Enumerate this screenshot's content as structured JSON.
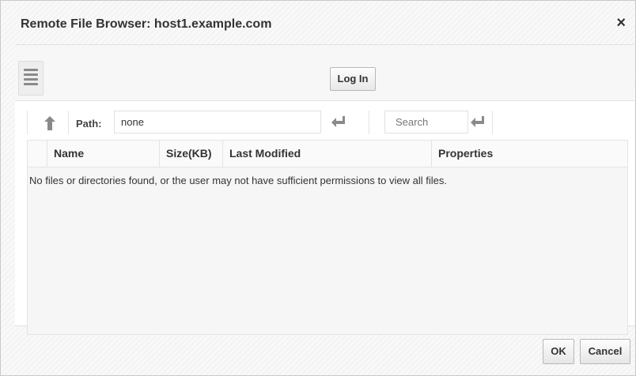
{
  "dialog": {
    "title": "Remote File Browser: host1.example.com",
    "close_glyph": "×"
  },
  "toolbar": {
    "menu_icon": "hamburger-icon",
    "login_label": "Log In"
  },
  "pathbar": {
    "up_icon": "up-arrow-icon",
    "path_label": "Path:",
    "path_value": "none",
    "path_go_icon": "enter-icon",
    "search_placeholder": "Search",
    "search_go_icon": "enter-icon"
  },
  "table": {
    "columns": [
      "Name",
      "Size(KB)",
      "Last Modified",
      "Properties"
    ],
    "empty_message": "No files or directories found, or the user may not have sufficient permissions to view all files."
  },
  "footer": {
    "ok_label": "OK",
    "cancel_label": "Cancel"
  },
  "colors": {
    "background": "#f4f4f4",
    "panel": "#ffffff",
    "text": "#333333",
    "icon": "#8a8a8a"
  }
}
